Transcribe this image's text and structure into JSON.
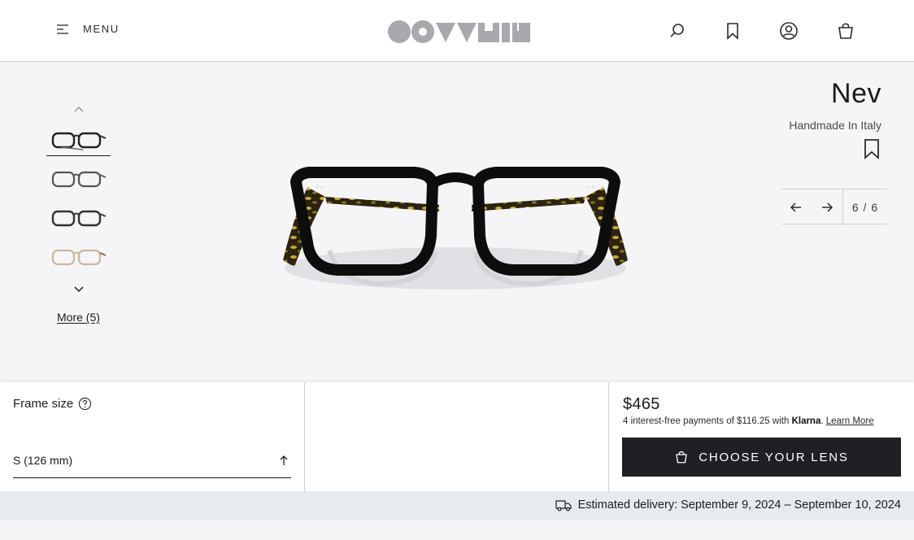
{
  "header": {
    "menu_label": "MENU"
  },
  "gallery": {
    "more_label": "More (5)"
  },
  "product": {
    "name": "Nev",
    "subtitle": "Handmade In Italy",
    "pager": "6 / 6"
  },
  "config": {
    "frame_size_label": "Frame size",
    "frame_size_value": "S (126 mm)"
  },
  "purchase": {
    "price": "$465",
    "klarna_text": "4 interest-free payments of $116.25 with",
    "klarna_brand": "Klarna",
    "klarna_link": "Learn More",
    "cta_label": "CHOOSE YOUR LENS"
  },
  "delivery": {
    "text": "Estimated delivery: September 9, 2024 – September 10, 2024"
  },
  "colors": {
    "accent": "#1f1f24",
    "background": "#f5f5f8",
    "delivery_bar": "#e7ebee"
  }
}
